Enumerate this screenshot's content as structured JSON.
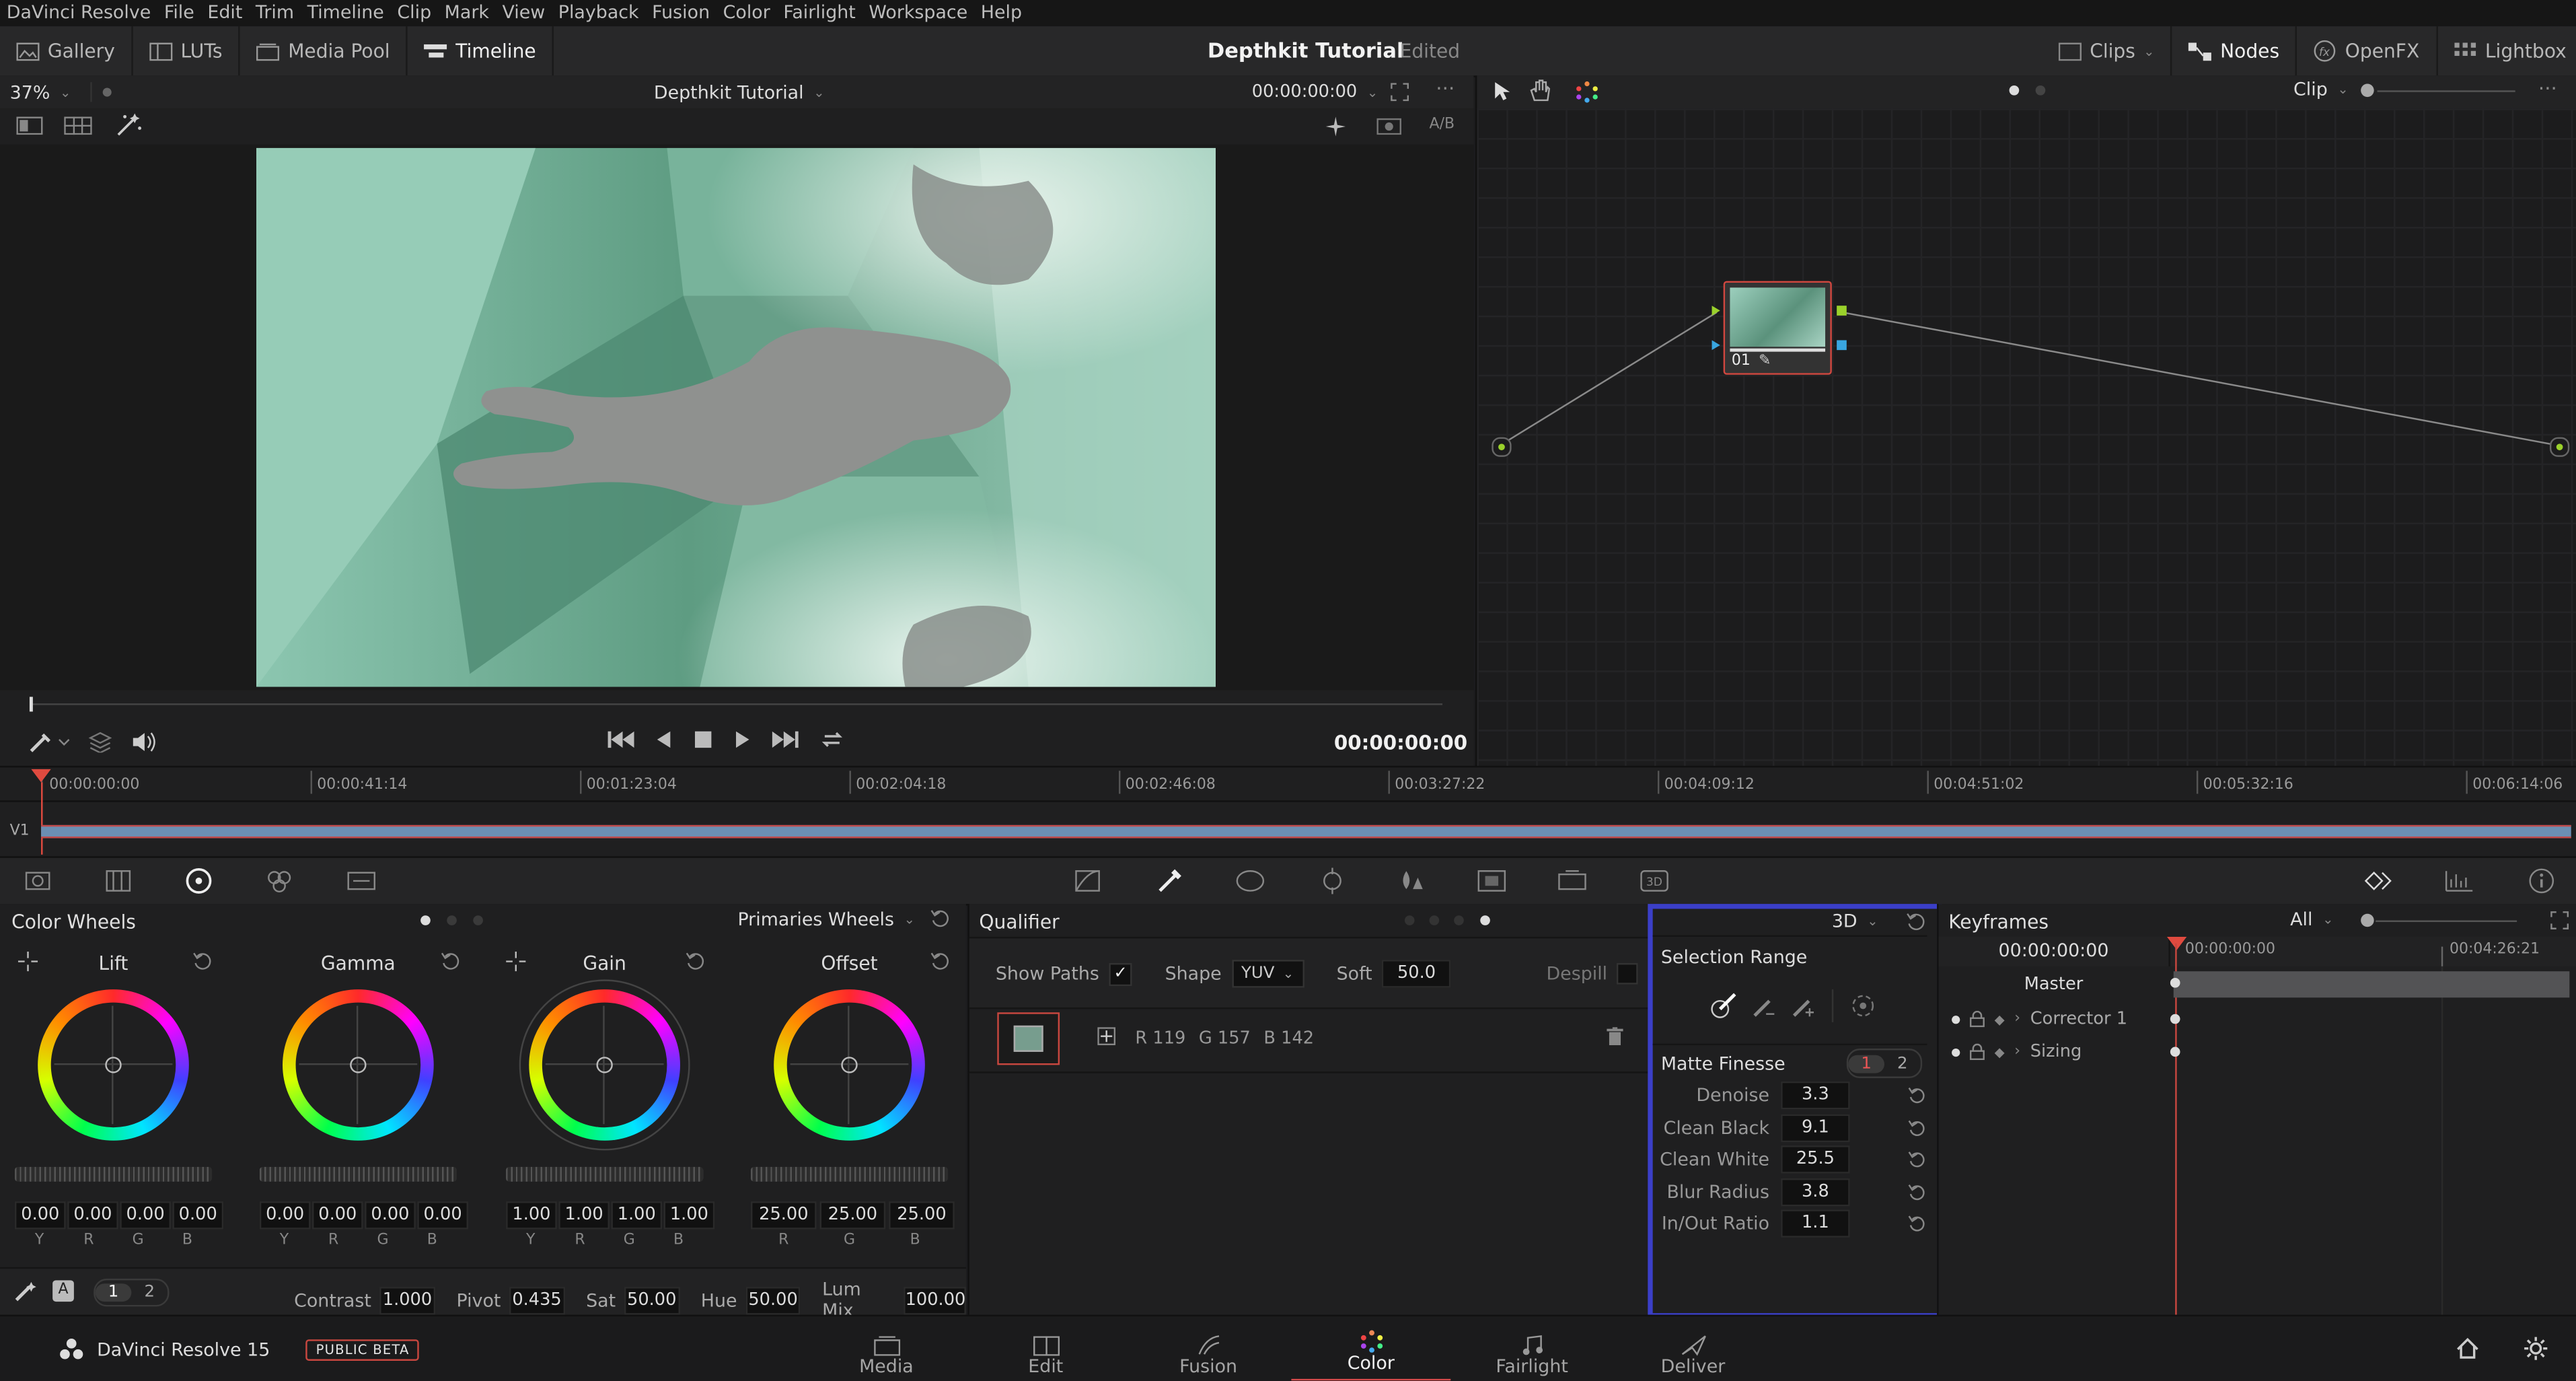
{
  "menu": [
    "DaVinci Resolve",
    "File",
    "Edit",
    "Trim",
    "Timeline",
    "Clip",
    "Mark",
    "View",
    "Playback",
    "Fusion",
    "Color",
    "Fairlight",
    "Workspace",
    "Help"
  ],
  "toolbar": {
    "left": [
      "Gallery",
      "LUTs",
      "Media Pool",
      "Timeline"
    ],
    "project_title": "Depthkit Tutorial",
    "status": "Edited",
    "right": [
      "Clips",
      "Nodes",
      "OpenFX",
      "Lightbox"
    ]
  },
  "viewer": {
    "zoom": "37%",
    "clip_name": "Depthkit Tutorial",
    "header_timecode": "00:00:00:00",
    "ab_label": "A/B",
    "transport_timecode": "00:00:00:00"
  },
  "node_editor": {
    "mode": "Clip",
    "node_label": "01"
  },
  "timeline": {
    "track": "V1",
    "timecodes": [
      "00:00:00:00",
      "00:00:41:14",
      "00:01:23:04",
      "00:02:04:18",
      "00:02:46:08",
      "00:03:27:22",
      "00:04:09:12",
      "00:04:51:02",
      "00:05:32:16",
      "00:06:14:06"
    ]
  },
  "color_wheels": {
    "title": "Color Wheels",
    "mode": "Primaries Wheels",
    "wheels": [
      {
        "name": "Lift",
        "values": [
          "0.00",
          "0.00",
          "0.00",
          "0.00"
        ],
        "channels": [
          "Y",
          "R",
          "G",
          "B"
        ]
      },
      {
        "name": "Gamma",
        "values": [
          "0.00",
          "0.00",
          "0.00",
          "0.00"
        ],
        "channels": [
          "Y",
          "R",
          "G",
          "B"
        ]
      },
      {
        "name": "Gain",
        "values": [
          "1.00",
          "1.00",
          "1.00",
          "1.00"
        ],
        "channels": [
          "Y",
          "R",
          "G",
          "B"
        ]
      },
      {
        "name": "Offset",
        "values": [
          "25.00",
          "25.00",
          "25.00"
        ],
        "channels": [
          "R",
          "G",
          "B"
        ]
      }
    ],
    "auto_label": "A",
    "page1": "1",
    "page2": "2",
    "contrast_label": "Contrast",
    "contrast": "1.000",
    "pivot_label": "Pivot",
    "pivot": "0.435",
    "sat_label": "Sat",
    "sat": "50.00",
    "hue_label": "Hue",
    "hue": "50.00",
    "lummix_label": "Lum Mix",
    "lummix": "100.00"
  },
  "qualifier": {
    "title": "Qualifier",
    "show_paths_label": "Show Paths",
    "shape_label": "Shape",
    "shape_value": "YUV",
    "soft_label": "Soft",
    "soft_value": "50.0",
    "despill_label": "Despill",
    "swatch_color": "#779d8e",
    "r": "R 119",
    "g": "G 157",
    "b": "B 142"
  },
  "selection": {
    "mode": "3D",
    "title": "Selection Range",
    "matte_title": "Matte Finesse",
    "tab1": "1",
    "tab2": "2",
    "params": [
      {
        "label": "Denoise",
        "value": "3.3"
      },
      {
        "label": "Clean Black",
        "value": "9.1"
      },
      {
        "label": "Clean White",
        "value": "25.5"
      },
      {
        "label": "Blur Radius",
        "value": "3.8"
      },
      {
        "label": "In/Out Ratio",
        "value": "1.1"
      }
    ]
  },
  "keyframes": {
    "title": "Keyframes",
    "filter": "All",
    "timecode": "00:00:00:00",
    "ruler_start": "00:00:00:00",
    "ruler_end": "00:04:26:21",
    "rows": [
      "Master",
      "Corrector 1",
      "Sizing"
    ]
  },
  "pagebar": {
    "app_name": "DaVinci Resolve 15",
    "badge": "PUBLIC BETA",
    "pages": [
      "Media",
      "Edit",
      "Fusion",
      "Color",
      "Fairlight",
      "Deliver"
    ],
    "active_page": "Color"
  },
  "colors": {
    "accent_red": "#d84b4b",
    "highlight_blue": "#3b3fc8",
    "node_outline": "#d0473f"
  }
}
